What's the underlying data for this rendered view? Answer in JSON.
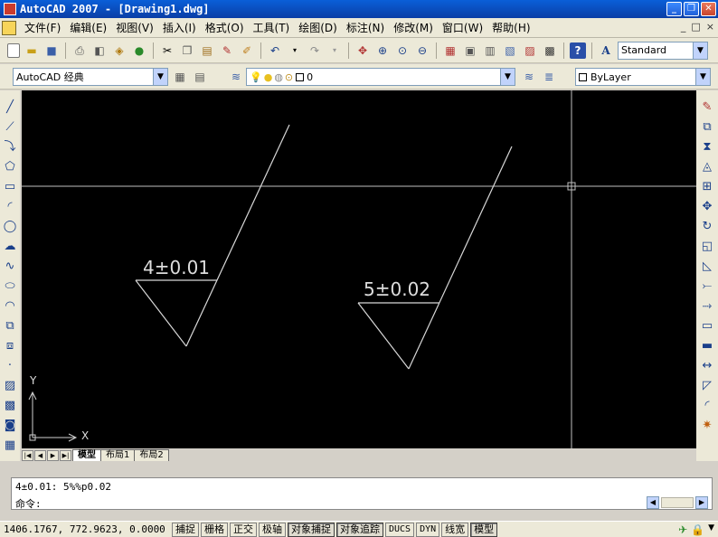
{
  "window": {
    "title": "AutoCAD 2007 - [Drawing1.dwg]",
    "minimize": "_",
    "restore": "❐",
    "close": "✕"
  },
  "menu": {
    "items": [
      "文件(F)",
      "编辑(E)",
      "视图(V)",
      "插入(I)",
      "格式(O)",
      "工具(T)",
      "绘图(D)",
      "标注(N)",
      "修改(M)",
      "窗口(W)",
      "帮助(H)"
    ],
    "doc_controls": [
      "_",
      "□",
      "×"
    ]
  },
  "toolbar": {
    "text_style": "Standard",
    "workspace": "AutoCAD 经典",
    "layer": "0",
    "color": "ByLayer"
  },
  "drawing": {
    "symbol1_label": "4±0.01",
    "symbol2_label": "5±0.02",
    "ucs_x": "X",
    "ucs_y": "Y"
  },
  "layout_tabs": [
    "模型",
    "布局1",
    "布局2"
  ],
  "command": {
    "history_line": "4±0.01: 5%%p0.02",
    "prompt": "命令:"
  },
  "status": {
    "coordinates": "1406.1767, 772.9623, 0.0000",
    "toggles": [
      {
        "label": "捕捉",
        "on": false
      },
      {
        "label": "栅格",
        "on": false
      },
      {
        "label": "正交",
        "on": false
      },
      {
        "label": "极轴",
        "on": false
      },
      {
        "label": "对象捕捉",
        "on": true
      },
      {
        "label": "对象追踪",
        "on": true
      },
      {
        "label": "DUCS",
        "on": false
      },
      {
        "label": "DYN",
        "on": false
      },
      {
        "label": "线宽",
        "on": false
      },
      {
        "label": "模型",
        "on": true
      }
    ]
  },
  "colors": {
    "canvas_background": "#000000",
    "drawing_lines": "#d8d8d8",
    "title_bar": "#0a4cc4"
  }
}
